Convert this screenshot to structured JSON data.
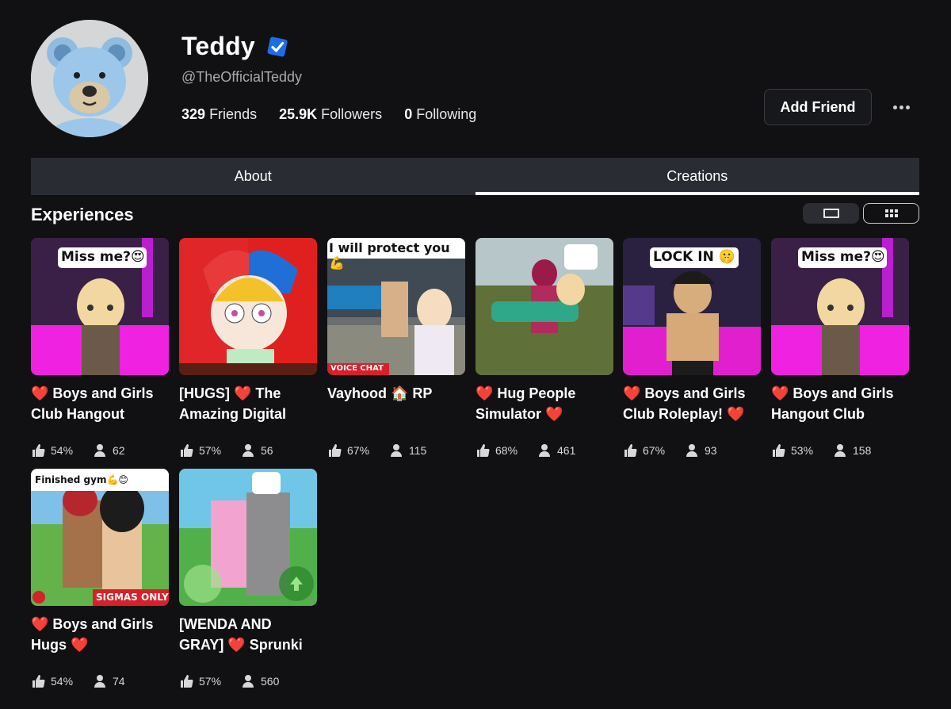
{
  "profile": {
    "display_name": "Teddy",
    "handle": "@TheOfficialTeddy",
    "stats": [
      {
        "value": "329",
        "label": "Friends"
      },
      {
        "value": "25.9K",
        "label": "Followers"
      },
      {
        "value": "0",
        "label": "Following"
      }
    ],
    "add_friend_label": "Add Friend"
  },
  "tabs": [
    {
      "label": "About",
      "active": false
    },
    {
      "label": "Creations",
      "active": true
    }
  ],
  "section": {
    "title": "Experiences"
  },
  "experiences": [
    {
      "title_a": "❤️ Boys and Girls",
      "title_b": "Club Hangout",
      "rating": "54%",
      "players": "62",
      "caption": "Miss me?😍"
    },
    {
      "title_a": "[HUGS] ❤️ The",
      "title_b": "Amazing Digital",
      "rating": "57%",
      "players": "56",
      "caption": ""
    },
    {
      "title_a": "Vayhood 🏠 RP",
      "title_b": "",
      "rating": "67%",
      "players": "115",
      "caption": "I will protect you💪",
      "badge": "VOICE CHAT"
    },
    {
      "title_a": "❤️ Hug People",
      "title_b": "Simulator ❤️",
      "rating": "68%",
      "players": "461",
      "caption": "😍"
    },
    {
      "title_a": "❤️ Boys and Girls",
      "title_b": "Club Roleplay! ❤️",
      "rating": "67%",
      "players": "93",
      "caption": "LOCK IN 🤫"
    },
    {
      "title_a": "❤️ Boys and Girls",
      "title_b": "Hangout Club",
      "rating": "53%",
      "players": "158",
      "caption": "Miss me?😍"
    },
    {
      "title_a": "❤️ Boys and Girls",
      "title_b": "Hugs ❤️",
      "rating": "54%",
      "players": "74",
      "caption": "Finished gym💪😊",
      "badge": "SIGMAS ONLY"
    },
    {
      "title_a": "[WENDA AND",
      "title_b": "GRAY] ❤️ Sprunki",
      "rating": "57%",
      "players": "560",
      "caption": "😊"
    }
  ],
  "colors": {
    "background": "#111114",
    "tab_bar": "#2a2c33",
    "verified": "#1a6fe8",
    "heart": "#e8365a"
  }
}
